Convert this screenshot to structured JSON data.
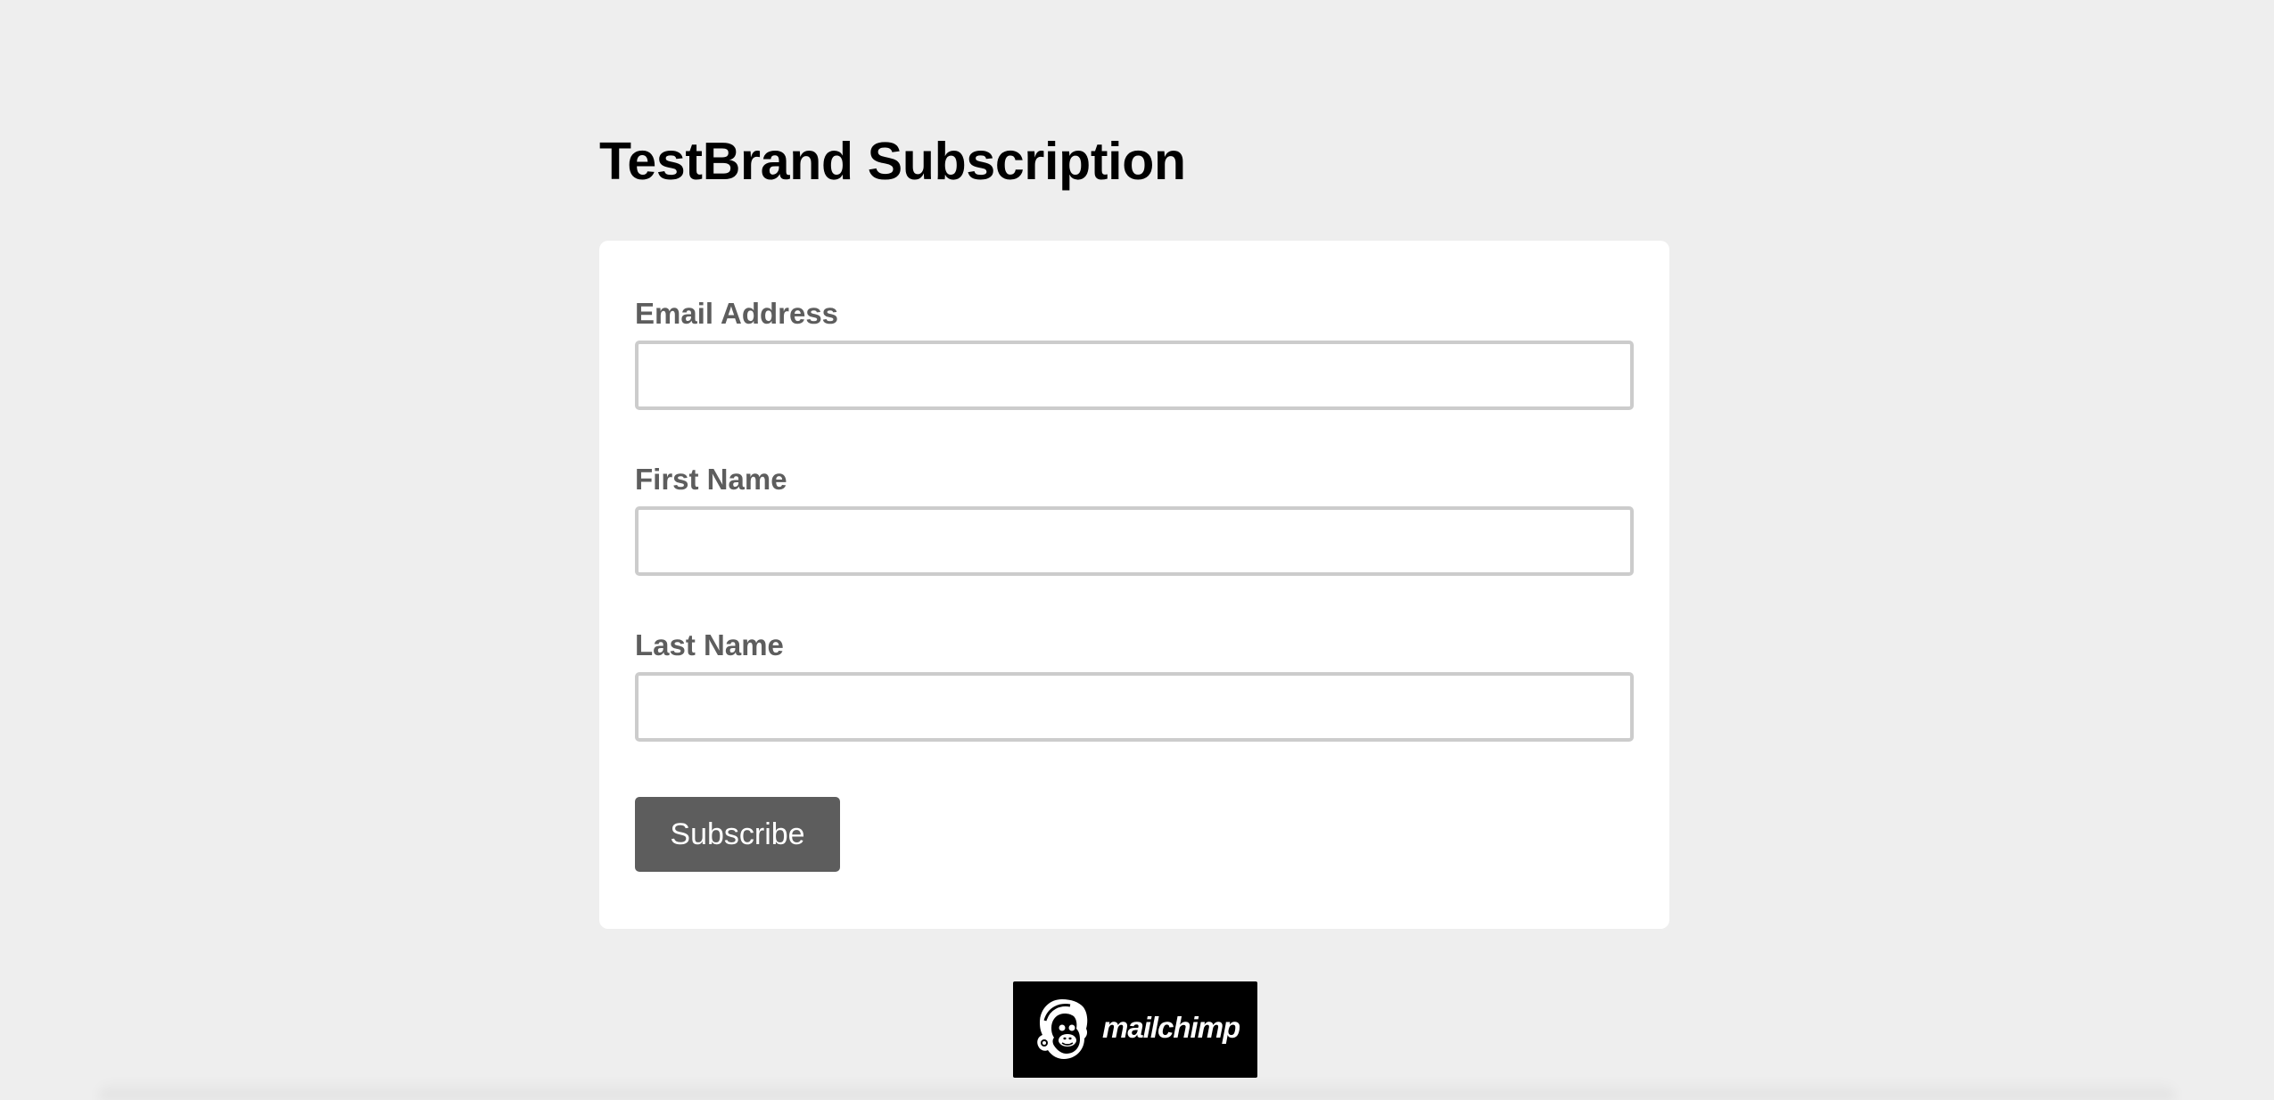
{
  "page": {
    "title": "TestBrand Subscription"
  },
  "form": {
    "fields": [
      {
        "label": "Email Address",
        "value": "",
        "placeholder": ""
      },
      {
        "label": "First Name",
        "value": "",
        "placeholder": ""
      },
      {
        "label": "Last Name",
        "value": "",
        "placeholder": ""
      }
    ],
    "submit_label": "Subscribe"
  },
  "footer": {
    "badge_text": "mailchimp",
    "badge_icon": "mailchimp-freddie-icon"
  },
  "colors": {
    "background": "#eeeeee",
    "card": "#ffffff",
    "label": "#5d5d5d",
    "button": "#5d5d5d",
    "input_border": "#cccccc",
    "badge": "#000000"
  }
}
